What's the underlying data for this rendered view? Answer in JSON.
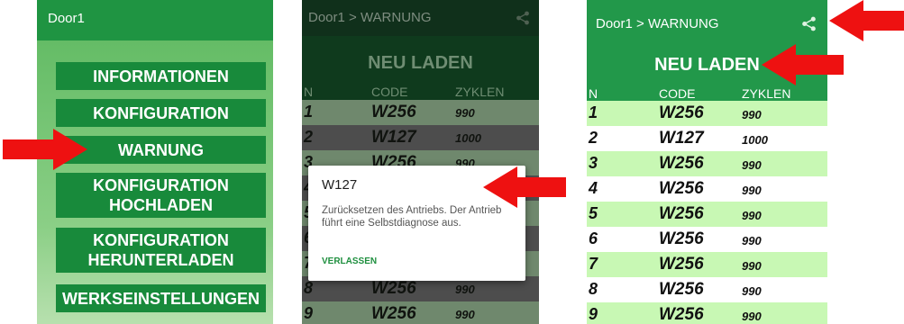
{
  "screen_menu": {
    "title": "Door1",
    "items": [
      {
        "line1": "INFORMATIONEN",
        "line2": ""
      },
      {
        "line1": "KONFIGURATION",
        "line2": ""
      },
      {
        "line1": "WARNUNG",
        "line2": ""
      },
      {
        "line1": "KONFIGURATION",
        "line2": "HOCHLADEN"
      },
      {
        "line1": "KONFIGURATION",
        "line2": "HERUNTERLADEN"
      },
      {
        "line1": "WERKSEINSTELLUNGEN",
        "line2": ""
      }
    ]
  },
  "screen_dialog": {
    "title": "Door1 > WARNUNG",
    "reload": "NEU LADEN",
    "columns": [
      "N",
      "CODE",
      "ZYKLEN"
    ],
    "rows": [
      {
        "n": "1",
        "code": "W256",
        "cycles": "990"
      },
      {
        "n": "2",
        "code": "W127",
        "cycles": "1000"
      },
      {
        "n": "3",
        "code": "W256",
        "cycles": "990"
      },
      {
        "n": "4",
        "code": "",
        "cycles": ""
      },
      {
        "n": "5",
        "code": "",
        "cycles": ""
      },
      {
        "n": "6",
        "code": "",
        "cycles": ""
      },
      {
        "n": "7",
        "code": "",
        "cycles": ""
      },
      {
        "n": "8",
        "code": "W256",
        "cycles": "990"
      },
      {
        "n": "9",
        "code": "W256",
        "cycles": "990"
      }
    ],
    "dialog": {
      "title": "W127",
      "body": "Zurücksetzen des Antriebs. Der Antrieb führt eine Selbstdiagnose aus.",
      "button": "VERLASSEN"
    }
  },
  "screen_list": {
    "title": "Door1 > WARNUNG",
    "reload": "NEU LADEN",
    "columns": [
      "N",
      "CODE",
      "ZYKLEN"
    ],
    "rows": [
      {
        "n": "1",
        "code": "W256",
        "cycles": "990"
      },
      {
        "n": "2",
        "code": "W127",
        "cycles": "1000"
      },
      {
        "n": "3",
        "code": "W256",
        "cycles": "990"
      },
      {
        "n": "4",
        "code": "W256",
        "cycles": "990"
      },
      {
        "n": "5",
        "code": "W256",
        "cycles": "990"
      },
      {
        "n": "6",
        "code": "W256",
        "cycles": "990"
      },
      {
        "n": "7",
        "code": "W256",
        "cycles": "990"
      },
      {
        "n": "8",
        "code": "W256",
        "cycles": "990"
      },
      {
        "n": "9",
        "code": "W256",
        "cycles": "990"
      }
    ]
  },
  "colors": {
    "appbar_green": "#1f9442",
    "button_green": "#188a3b",
    "row_highlight": "#c8f8b4",
    "arrow_red": "#ee1111"
  },
  "icons": [
    "share-icon",
    "red-arrow-pointer"
  ]
}
